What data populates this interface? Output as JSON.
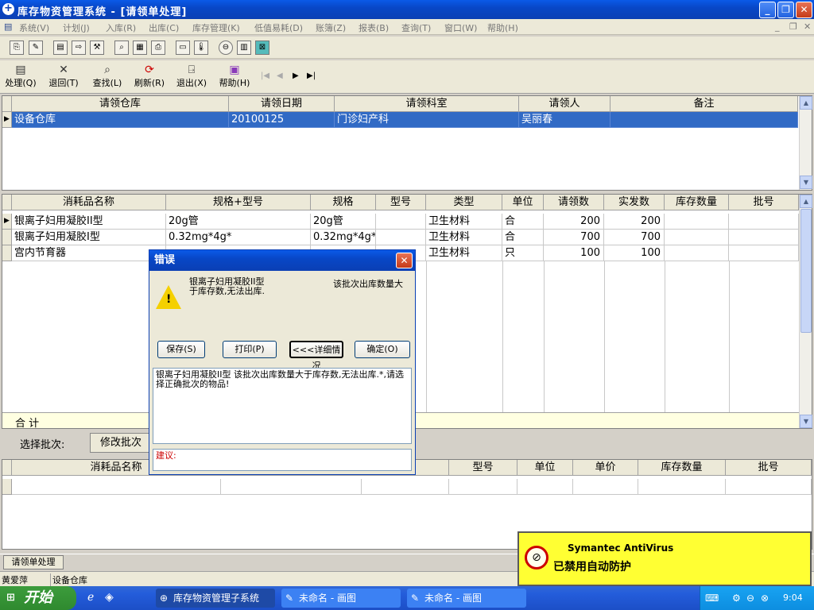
{
  "window": {
    "title": "库存物资管理系统 - [请领单处理]"
  },
  "menu": [
    "系统(V)",
    "计划(J)",
    "入库(R)",
    "出库(C)",
    "库存管理(K)",
    "低值易耗(D)",
    "账簿(Z)",
    "报表(B)",
    "查询(T)",
    "窗口(W)",
    "帮助(H)"
  ],
  "toolbar2": [
    {
      "label": "处理(Q)",
      "icon": "process-icon"
    },
    {
      "label": "退回(T)",
      "icon": "close-x-icon"
    },
    {
      "label": "查找(L)",
      "icon": "magnifier-icon"
    },
    {
      "label": "刷新(R)",
      "icon": "refresh-icon"
    },
    {
      "label": "退出(X)",
      "icon": "exit-door-icon"
    },
    {
      "label": "帮助(H)",
      "icon": "help-book-icon"
    }
  ],
  "grid1": {
    "headers": [
      "请领仓库",
      "请领日期",
      "请领科室",
      "请领人",
      "备注"
    ],
    "rows": [
      [
        "设备仓库",
        "20100125",
        "门诊妇产科",
        "吴丽春",
        ""
      ]
    ]
  },
  "grid2": {
    "headers": [
      "消耗品名称",
      "规格+型号",
      "规格",
      "型号",
      "类型",
      "单位",
      "请领数",
      "实发数",
      "库存数量",
      "批号"
    ],
    "rows": [
      [
        "银离子妇用凝胶II型",
        "20g管",
        "20g管",
        "",
        "卫生材料",
        "合",
        "200",
        "200",
        "",
        ""
      ],
      [
        "银离子妇用凝胶I型",
        "0.32mg*4g*",
        "0.32mg*4g*",
        "",
        "卫生材料",
        "合",
        "700",
        "700",
        "",
        ""
      ],
      [
        "宫内节育器",
        "",
        "",
        "",
        "卫生材料",
        "只",
        "100",
        "100",
        "",
        ""
      ]
    ],
    "total_label": "合  计"
  },
  "batch": {
    "label": "选择批次:",
    "edit_button": "修改批次"
  },
  "grid3": {
    "headers": [
      "消耗品名称",
      "",
      "",
      "型号",
      "单位",
      "单价",
      "库存数量",
      "批号"
    ]
  },
  "dialog": {
    "title": "错误",
    "message_left": "银离子妇用凝胶II型\n于库存数,无法出库.",
    "message_right": "该批次出库数量大",
    "buttons": [
      "保存(S)",
      "打印(P)",
      "<<<详细情况",
      "确定(O)"
    ],
    "detail_text": "银离子妇用凝胶II型          该批次出库数量大于库存数,无法出库.*,请选择正确批次的物品!",
    "suggest_label": "建议:"
  },
  "mdi_tab": "请领单处理",
  "statusbar": [
    "黄爱萍",
    "设备仓库"
  ],
  "antivirus": {
    "title": "Symantec AntiVirus",
    "message": "已禁用自动防护"
  },
  "taskbar": {
    "start": "开始",
    "tasks": [
      "库存物资管理子系统",
      "未命名 - 画图",
      "未命名 - 画图"
    ],
    "clock": "9:04"
  }
}
